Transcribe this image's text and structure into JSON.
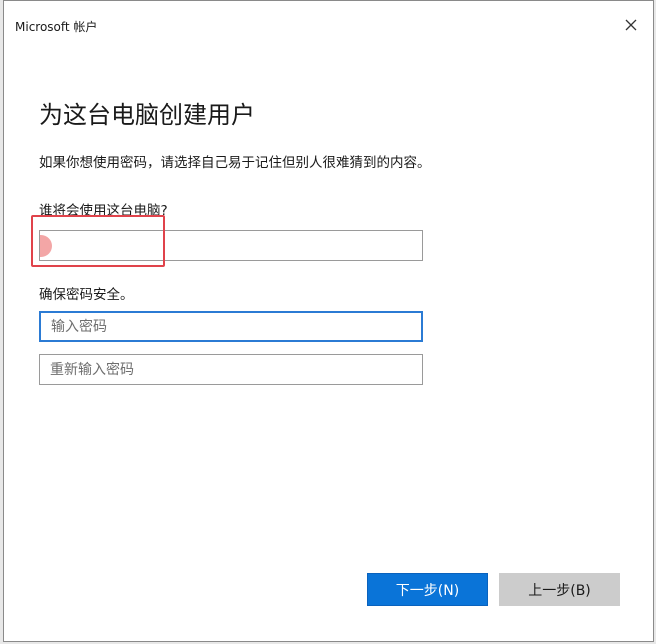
{
  "window": {
    "title": "Microsoft 帐户"
  },
  "page": {
    "heading": "为这台电脑创建用户",
    "subtitle": "如果你想使用密码，请选择自己易于记住但别人很难猜到的内容。"
  },
  "user_section": {
    "label": "谁将会使用这台电脑?",
    "username_value": ""
  },
  "password_section": {
    "label": "确保密码安全。",
    "password_placeholder": "输入密码",
    "confirm_placeholder": "重新输入密码"
  },
  "buttons": {
    "next_label": "下一步(N)",
    "back_label": "上一步(B)"
  },
  "colors": {
    "accent": "#0a74d8",
    "highlight": "#e0434b",
    "focus_border": "#2b7bd4"
  },
  "icons": {
    "close": "close-icon"
  }
}
